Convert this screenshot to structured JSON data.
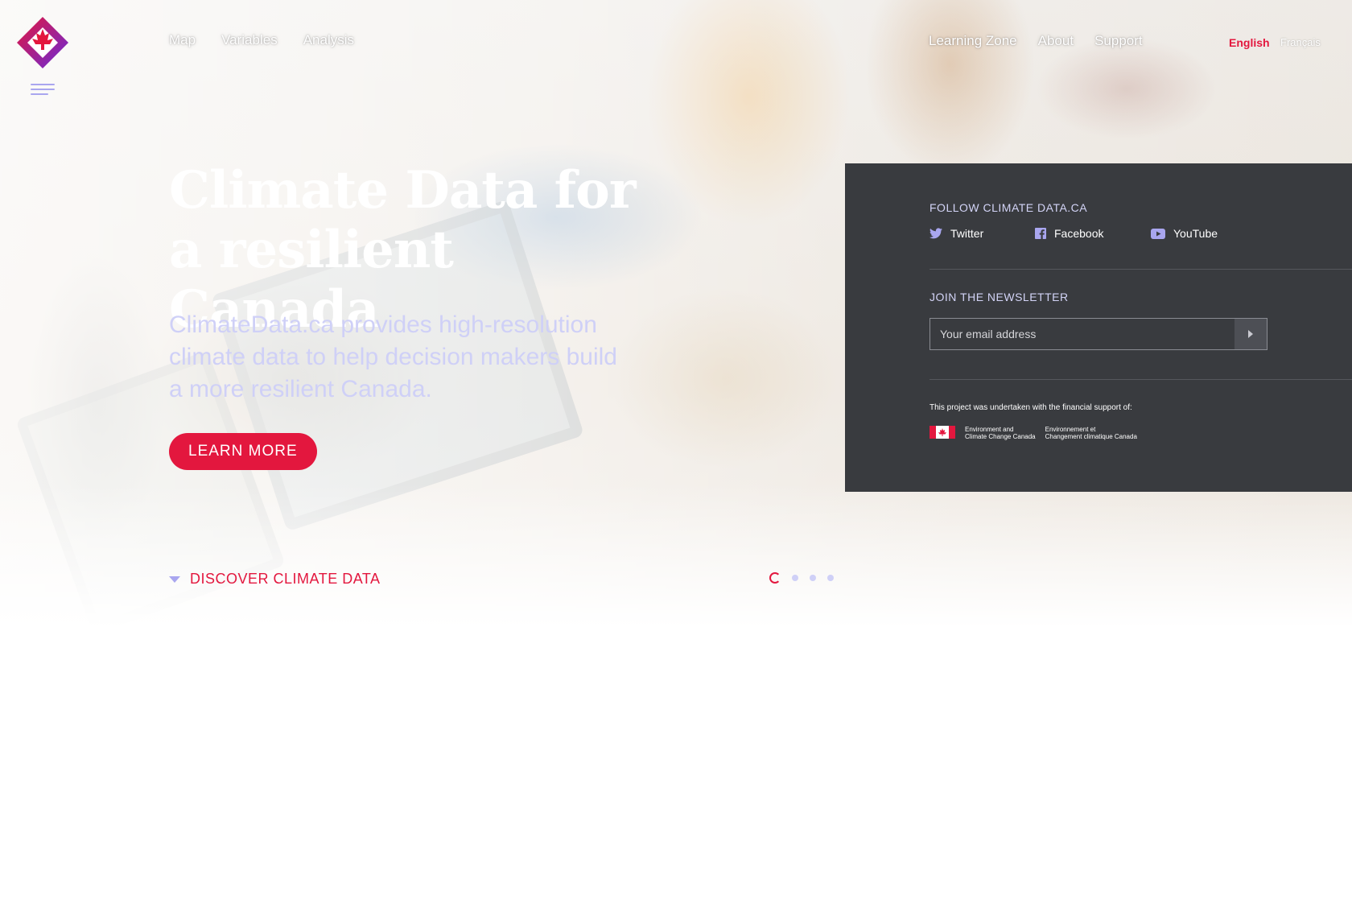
{
  "logo": {
    "icon": "climatedata-maple-diamond-logo",
    "colors": [
      "#e3173e",
      "#6a2bd9",
      "#a9a6ef"
    ]
  },
  "menu": {
    "icon": "hamburger-menu-icon"
  },
  "nav_main": [
    {
      "label": "Map"
    },
    {
      "label": "Variables"
    },
    {
      "label": "Analysis"
    }
  ],
  "nav_secondary": [
    {
      "label": "Learning Zone"
    },
    {
      "label": "About"
    },
    {
      "label": "Support"
    }
  ],
  "language": {
    "english": "English",
    "french": "Français",
    "active": "English"
  },
  "hero": {
    "title": "Climate Data for a resilient Canada",
    "subtitle": "ClimateData.ca provides high-resolution climate data to help decision makers build a more resilient Canada.",
    "cta": "LEARN MORE",
    "discover": "DISCOVER CLIMATE DATA",
    "slides": {
      "count": 4,
      "active": 1
    }
  },
  "panel": {
    "follow_title": "FOLLOW CLIMATE DATA.CA",
    "social": [
      {
        "label": "Twitter",
        "icon": "twitter-icon"
      },
      {
        "label": "Facebook",
        "icon": "facebook-icon"
      },
      {
        "label": "YouTube",
        "icon": "youtube-icon"
      }
    ],
    "newsletter_title": "JOIN THE NEWSLETTER",
    "email_placeholder": "Your email address",
    "support_text": "This project was undertaken with the financial support of:",
    "gov_en": [
      "Environment and",
      "Climate Change Canada"
    ],
    "gov_fr": [
      "Environnement et",
      "Changement climatique Canada"
    ]
  },
  "colors": {
    "accent": "#e3173e",
    "lavender": "#a9a6ef",
    "panel_bg": "#393b3f"
  }
}
